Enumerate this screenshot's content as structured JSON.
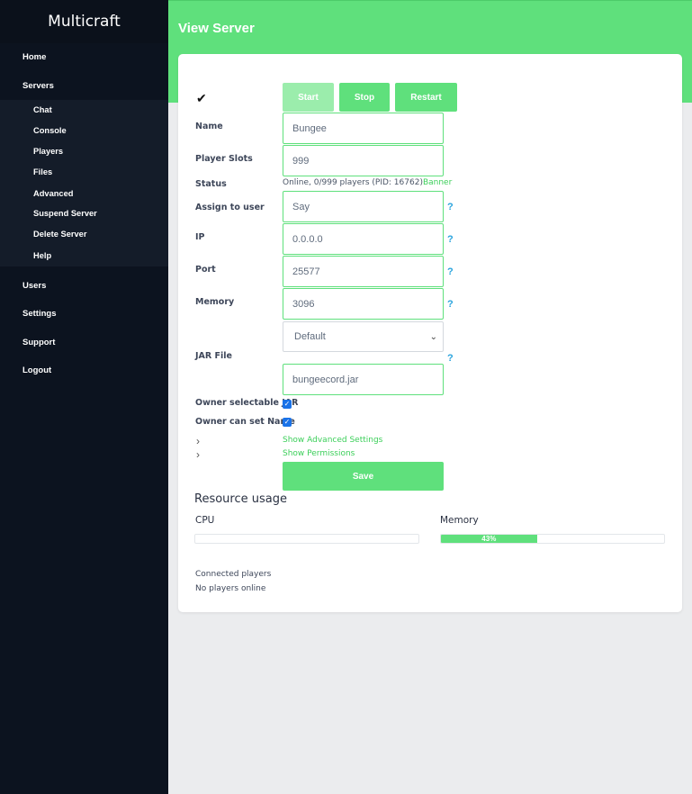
{
  "sidebar": {
    "brand": "Multicraft",
    "items": [
      {
        "label": "Home"
      },
      {
        "label": "Servers"
      },
      {
        "label": "Users"
      },
      {
        "label": "Settings"
      },
      {
        "label": "Support"
      },
      {
        "label": "Logout"
      }
    ],
    "sub_items": [
      {
        "label": "Chat"
      },
      {
        "label": "Console"
      },
      {
        "label": "Players"
      },
      {
        "label": "Files"
      },
      {
        "label": "Advanced"
      },
      {
        "label": "Suspend Server"
      },
      {
        "label": "Delete Server"
      },
      {
        "label": "Help"
      }
    ]
  },
  "header": {
    "title": "View Server"
  },
  "controls": {
    "status_icon": "checkmark-icon",
    "start": "Start",
    "stop": "Stop",
    "restart": "Restart"
  },
  "form": {
    "name_label": "Name",
    "name_value": "Bungee",
    "slots_label": "Player Slots",
    "slots_value": "999",
    "status_label": "Status",
    "status_text": "Online, 0/999 players (PID: 16762)",
    "status_link": "Banner",
    "assign_label": "Assign to user",
    "assign_value": "Say",
    "ip_label": "IP",
    "ip_value": "0.0.0.0",
    "port_label": "Port",
    "port_value": "25577",
    "memory_label": "Memory",
    "memory_value": "3096",
    "jar_label": "JAR File",
    "jar_select": "Default",
    "jar_value": "bungeecord.jar",
    "owner_jar_label": "Owner selectable JAR",
    "owner_name_label": "Owner can set Name",
    "help_mark": "?",
    "advanced_link": "Show Advanced Settings",
    "permissions_link": "Show Permissions",
    "save": "Save"
  },
  "resources": {
    "title": "Resource usage",
    "cpu_label": "CPU",
    "memory_label": "Memory",
    "memory_percent": "43%",
    "memory_fraction": 0.43
  },
  "players": {
    "label": "Connected players",
    "status": "No players online"
  },
  "colors": {
    "accent": "#5fe07c",
    "sidebar": "#0c131f",
    "help": "#29a3dd"
  }
}
